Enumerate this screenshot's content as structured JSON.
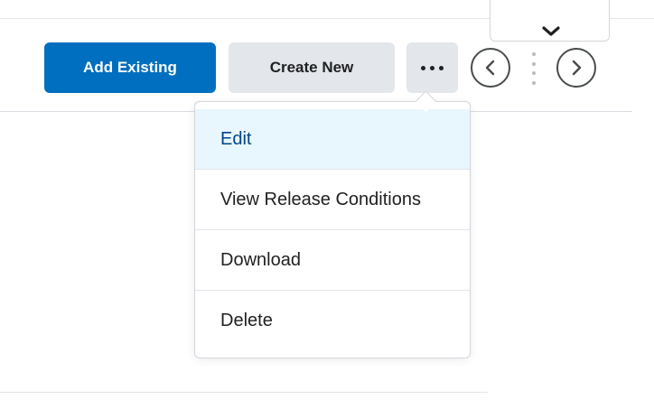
{
  "toolbar": {
    "add_existing_label": "Add Existing",
    "create_new_label": "Create New",
    "more_icon": "more-horizontal-icon",
    "previous_icon": "chevron-left-circle-icon",
    "next_icon": "chevron-right-circle-icon",
    "collapse_icon": "chevron-down-icon"
  },
  "menu": {
    "items": [
      {
        "label": "Edit",
        "active": true
      },
      {
        "label": "View Release Conditions",
        "active": false
      },
      {
        "label": "Download",
        "active": false
      },
      {
        "label": "Delete",
        "active": false
      }
    ]
  },
  "colors": {
    "primary": "#006fbf",
    "secondary_bg": "#e3e6eb",
    "menu_active_bg": "#e8f6fd",
    "menu_active_text": "#004489"
  }
}
